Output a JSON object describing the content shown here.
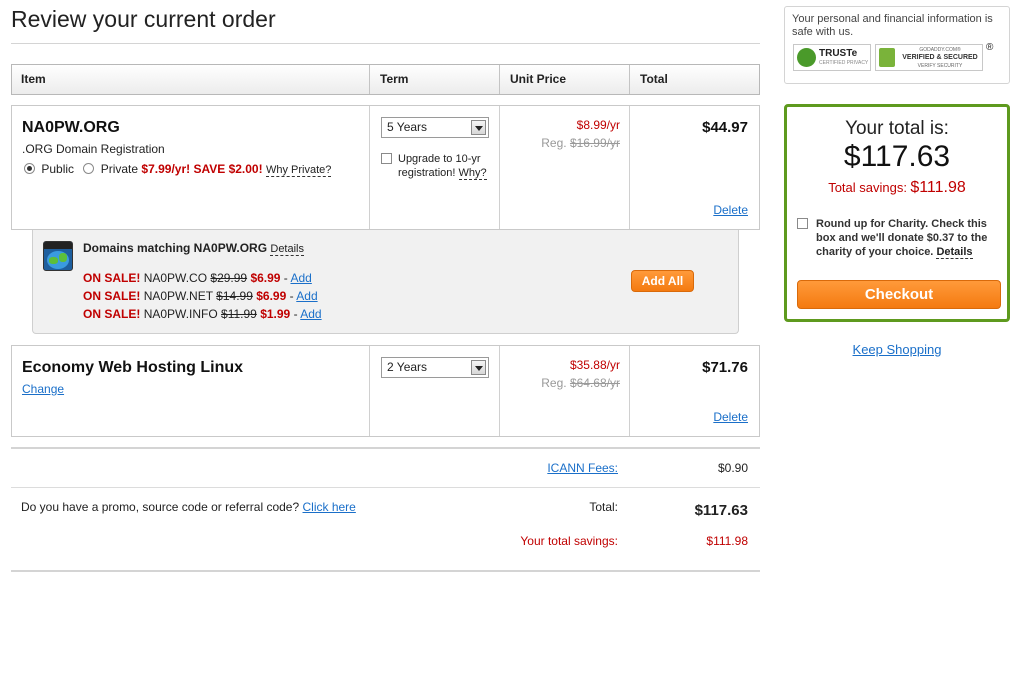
{
  "page": {
    "title": "Review your current order"
  },
  "table_header": {
    "item": "Item",
    "term": "Term",
    "unit_price": "Unit Price",
    "total": "Total"
  },
  "domain_item": {
    "name": "NA0PW.ORG",
    "description": ".ORG Domain Registration",
    "public_label": "Public",
    "private_label": "Private",
    "private_offer": "$7.99/yr! SAVE $2.00!",
    "why_private": "Why Private?",
    "term_selected": "5 Years",
    "upgrade_text": "Upgrade to 10-yr registration!",
    "upgrade_why": "Why?",
    "unit_price": "$8.99/yr",
    "reg_label": "Reg.",
    "reg_price": "$16.99/yr",
    "total": "$44.97",
    "delete": "Delete"
  },
  "upsell": {
    "title": "Domains matching NA0PW.ORG",
    "details": "Details",
    "sale_label": "ON SALE!",
    "add_label": "Add",
    "add_all": "Add All",
    "items": [
      {
        "domain": "NA0PW.CO",
        "old_price": "$29.99",
        "new_price": "$6.99"
      },
      {
        "domain": "NA0PW.NET",
        "old_price": "$14.99",
        "new_price": "$6.99"
      },
      {
        "domain": "NA0PW.INFO",
        "old_price": "$11.99",
        "new_price": "$1.99"
      }
    ]
  },
  "hosting_item": {
    "name": "Economy Web Hosting Linux",
    "change": "Change",
    "term_selected": "2 Years",
    "unit_price": "$35.88/yr",
    "reg_label": "Reg.",
    "reg_price": "$64.68/yr",
    "total": "$71.76",
    "delete": "Delete"
  },
  "summary": {
    "icann_label": "ICANN Fees:",
    "icann_value": "$0.90",
    "promo_text": "Do you have a promo, source code or referral code?",
    "promo_link": "Click here",
    "total_label": "Total:",
    "total_value": "$117.63",
    "savings_label": "Your total savings:",
    "savings_value": "$111.98"
  },
  "trust": {
    "text": "Your personal and financial information is safe with us.",
    "truste_label": "TRUSTe",
    "truste_sub": "CERTIFIED PRIVACY",
    "godaddy_top": "GODADDY.COM®",
    "godaddy_main": "VERIFIED & SECURED",
    "godaddy_sub": "VERIFY SECURITY",
    "registered": "®"
  },
  "total_box": {
    "heading": "Your total is:",
    "amount": "$117.63",
    "savings_label": "Total savings:",
    "savings_value": "$111.98",
    "charity_text": "Round up for Charity. Check this box and we'll donate $0.37 to the charity of your choice.",
    "charity_details": "Details",
    "checkout": "Checkout"
  },
  "keep_shopping": "Keep Shopping",
  "colors": {
    "accent_orange": "#f47a10",
    "box_green": "#5e9a1e",
    "sale_red": "#c00000",
    "link_blue": "#1a6fc9"
  }
}
